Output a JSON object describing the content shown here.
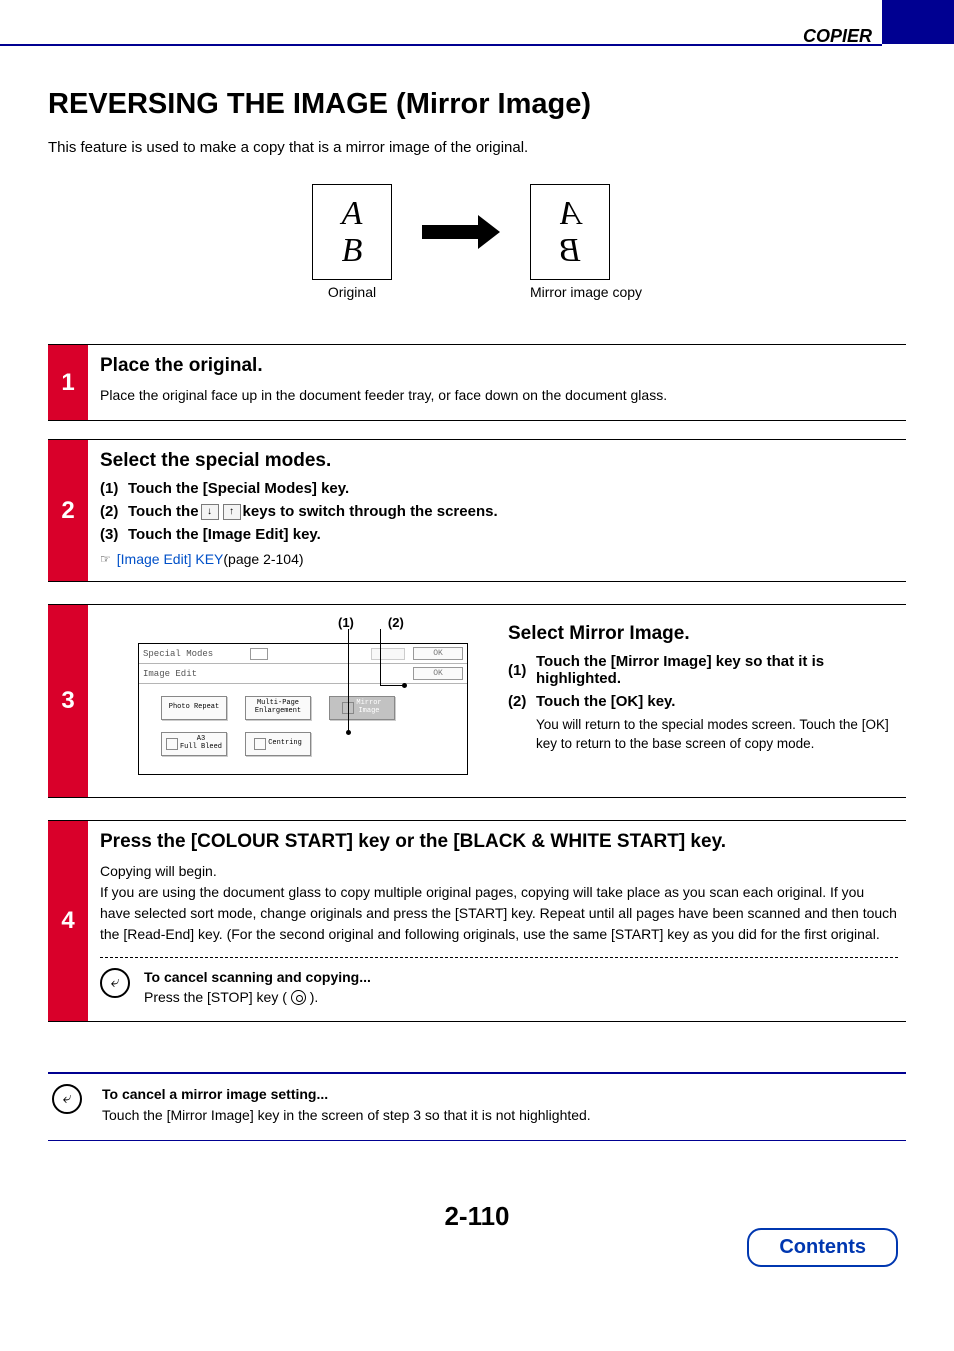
{
  "header": {
    "section": "COPIER"
  },
  "title": "REVERSING THE IMAGE (Mirror Image)",
  "intro": "This feature is used to make a copy that is a mirror image of the original.",
  "illustration": {
    "letterTop": "A",
    "letterBottom": "B",
    "originalLabel": "Original",
    "mirrorLabel": "Mirror image copy"
  },
  "step1": {
    "num": "1",
    "heading": "Place the original.",
    "text": "Place the original face up in the document feeder tray, or face down on the document glass."
  },
  "step2": {
    "num": "2",
    "heading": "Select the special modes.",
    "items": {
      "i1": {
        "n": "(1)",
        "text": "Touch the [Special Modes] key."
      },
      "i2a": {
        "n": "(2)",
        "textA": "Touch the ",
        "textB": " keys to switch through the screens."
      },
      "i3": {
        "n": "(3)",
        "text": "Touch the [Image Edit] key."
      }
    },
    "ref": {
      "icon": "☞",
      "link": "[Image Edit] KEY",
      "rest": " (page 2-104)"
    }
  },
  "step3": {
    "num": "3",
    "callouts": {
      "c1": "(1)",
      "c2": "(2)"
    },
    "panel": {
      "row1": "Special Modes",
      "row2": "Image Edit",
      "ok": "OK",
      "buttons": {
        "photoRepeat": "Photo Repeat",
        "multiPage": "Multi-Page\nEnlargement",
        "mirror": "Mirror\nImage",
        "a3": "A3\nFull Bleed",
        "centring": "Centring"
      }
    },
    "heading": "Select Mirror Image.",
    "items": {
      "i1": {
        "n": "(1)",
        "text": "Touch the [Mirror Image] key so that it is highlighted."
      },
      "i2": {
        "n": "(2)",
        "text": "Touch the [OK] key.",
        "desc": "You will return to the special modes screen. Touch the [OK] key to return to the base screen of copy mode."
      }
    }
  },
  "step4": {
    "num": "4",
    "heading": "Press the [COLOUR START] key or the [BLACK & WHITE START] key.",
    "p1": "Copying will begin.",
    "p2": "If you are using the document glass to copy multiple original pages, copying will take place as you scan each original. If you have selected sort mode, change originals and press the [START] key. Repeat until all pages have been scanned and then touch the [Read-End] key. (For the second original and following originals, use the same [START] key as you did for the first original.",
    "cancel": {
      "title": "To cancel scanning and copying...",
      "text": "Press the [STOP] key (",
      "text2": ")."
    }
  },
  "cancelBox": {
    "title": "To cancel a mirror image setting...",
    "text": "Touch the [Mirror Image] key in the screen of step 3 so that it is not highlighted."
  },
  "pageNumber": "2-110",
  "contentsButton": "Contents"
}
